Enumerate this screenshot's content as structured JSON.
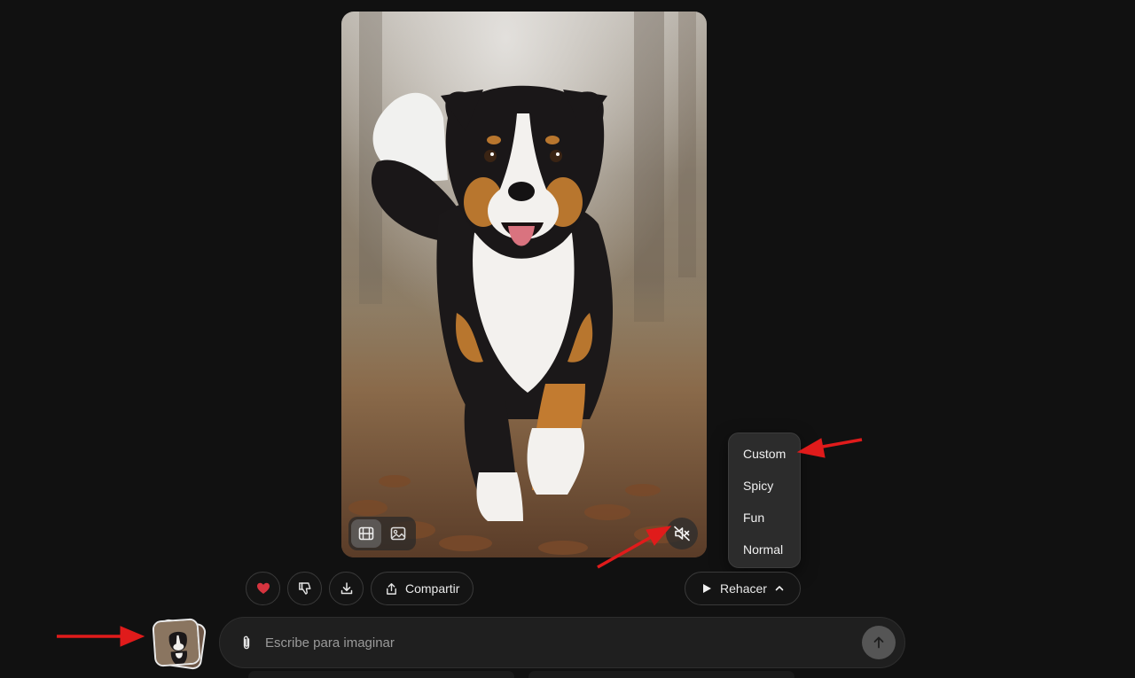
{
  "media": {
    "icons": {
      "video_mode": "film-icon",
      "image_mode": "image-icon",
      "mute": "volume-muted-icon"
    },
    "active_mode": "video"
  },
  "dropdown": {
    "items": [
      "Custom",
      "Spicy",
      "Fun",
      "Normal"
    ]
  },
  "actions": {
    "like_icon": "heart-icon",
    "like_color": "#d6343f",
    "dislike_icon": "thumbs-down-icon",
    "download_icon": "download-icon",
    "share_label": "Compartir",
    "share_icon": "share-icon",
    "redo_label": "Rehacer",
    "redo_icon": "play-icon"
  },
  "composer": {
    "placeholder": "Escribe para imaginar",
    "attach_icon": "paperclip-icon",
    "send_icon": "arrow-up-icon"
  },
  "colors": {
    "background": "#111111",
    "annotation_arrow": "#e01b1b"
  }
}
